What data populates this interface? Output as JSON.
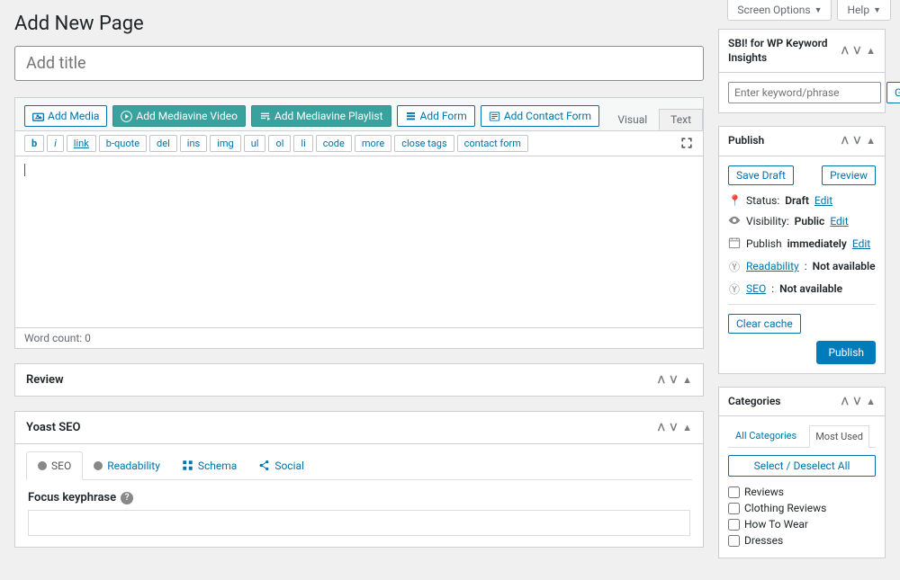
{
  "topTabs": {
    "screenOptions": "Screen Options",
    "help": "Help"
  },
  "pageTitle": "Add New Page",
  "titlePlaceholder": "Add title",
  "mediaButtons": {
    "addMedia": "Add Media",
    "addVideo": "Add Mediavine Video",
    "addPlaylist": "Add Mediavine Playlist",
    "addForm": "Add Form",
    "addContactForm": "Add Contact Form"
  },
  "editorTabs": {
    "visual": "Visual",
    "text": "Text"
  },
  "quicktags": [
    "b",
    "i",
    "link",
    "b-quote",
    "del",
    "ins",
    "img",
    "ul",
    "ol",
    "li",
    "code",
    "more",
    "close tags",
    "contact form"
  ],
  "wordCount": "Word count: 0",
  "review": {
    "title": "Review"
  },
  "yoast": {
    "title": "Yoast SEO",
    "tabs": {
      "seo": "SEO",
      "readability": "Readability",
      "schema": "Schema",
      "social": "Social"
    },
    "focusLabel": "Focus keyphrase"
  },
  "sbi": {
    "title": "SBI! for WP Keyword Insights",
    "placeholder": "Enter keyword/phrase",
    "get": "Get"
  },
  "publish": {
    "title": "Publish",
    "saveDraft": "Save Draft",
    "preview": "Preview",
    "statusLabel": "Status:",
    "statusValue": "Draft",
    "visibilityLabel": "Visibility:",
    "visibilityValue": "Public",
    "publishLabel": "Publish",
    "publishValue": "immediately",
    "readabilityLabel": "Readability",
    "seoLabel": "SEO",
    "notAvailable": "Not available",
    "edit": "Edit",
    "clearCache": "Clear cache",
    "publishButton": "Publish"
  },
  "categories": {
    "title": "Categories",
    "all": "All Categories",
    "mostUsed": "Most Used",
    "selectAll": "Select / Deselect All",
    "items": [
      "Reviews",
      "Clothing Reviews",
      "How To Wear",
      "Dresses"
    ]
  }
}
